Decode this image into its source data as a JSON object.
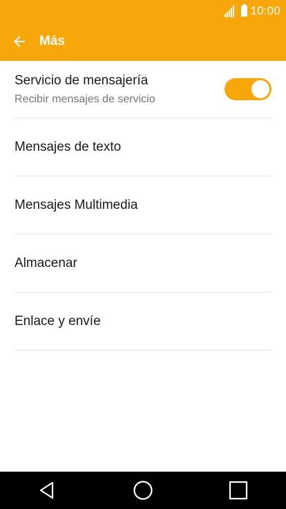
{
  "status_bar": {
    "time": "10:00",
    "signal_icon": "signal-icon",
    "battery_icon": "battery-icon"
  },
  "app_bar": {
    "back_icon": "arrow-back-icon",
    "title": "Más",
    "background_color": "#f8a70b"
  },
  "settings": {
    "service_messaging": {
      "title": "Servicio de mensajería",
      "subtitle": "Recibir mensajes de servicio",
      "enabled": true,
      "accent_color": "#f8a70b"
    },
    "items": [
      {
        "label": "Mensajes de texto"
      },
      {
        "label": "Mensajes Multimedia"
      },
      {
        "label": "Almacenar"
      },
      {
        "label": "Enlace y envíe"
      }
    ]
  },
  "nav_bar": {
    "back_icon": "nav-back-triangle-icon",
    "home_icon": "nav-home-circle-icon",
    "recents_icon": "nav-recents-square-icon"
  }
}
